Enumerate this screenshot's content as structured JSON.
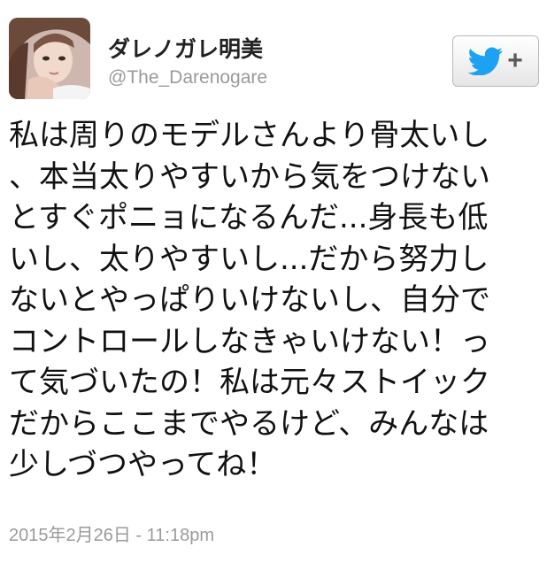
{
  "user": {
    "display_name": "ダレノガレ明美",
    "handle": "@The_Darenogare",
    "avatar_icon": "profile-photo"
  },
  "follow_button": {
    "icon": "twitter-bird-icon",
    "plus_label": "+",
    "accent_color": "#1da1f2"
  },
  "tweet": {
    "lines": [
      "私は周りのモデルさんより骨太いし",
      "、本当太りやすいから気をつけない",
      "とすぐポニョになるんだ...身長も低",
      "いし、太りやすいし...だから努力し",
      "ないとやっぱりいけないし、自分で",
      "コントロールしなきゃいけない！っ",
      "て気づいたの！私は元々ストイック",
      "だからここまでやるけど、みんなは",
      "少しづつやってね！"
    ]
  },
  "timestamp": "2015年2月26日 - 11:18pm"
}
